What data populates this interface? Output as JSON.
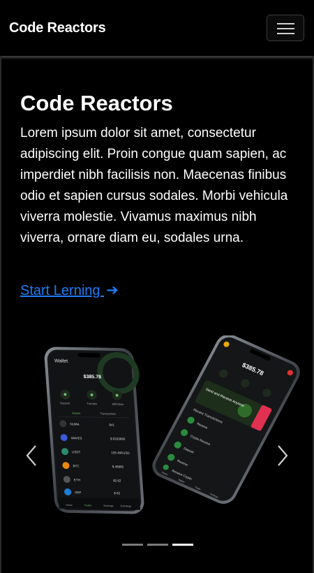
{
  "navbar": {
    "brand": "Code Reactors",
    "toggler_icon": "hamburger-menu-icon"
  },
  "hero": {
    "title": "Code Reactors",
    "text": "Lorem ipsum dolor sit amet, consectetur adipiscing elit. Proin congue quam sapien, ac imperdiet nibh facilisis non. Maecenas finibus odio et sapien cursus sodales. Morbi vehicula viverra molestie. Vivamus maximus nibh viverra, ornare diam eu, sodales urna.",
    "cta_label": "Start Lerning ",
    "cta_icon": "arrow-right-icon",
    "cta_color": "#1e7bf5"
  },
  "carousel": {
    "prev_icon": "chevron-left-icon",
    "next_icon": "chevron-right-icon",
    "slide_count": 3,
    "active_index": 2,
    "phone_left": {
      "app_title": "Wallet",
      "balance": "$385.78",
      "actions": [
        "Deposit",
        "Transfer",
        "Withdraw"
      ],
      "tabs": [
        "Assets",
        "Transactions"
      ],
      "assets": [
        {
          "symbol": "NUMA",
          "value": "$41"
        },
        {
          "symbol": "WAVES",
          "value": "$.6333695"
        },
        {
          "symbol": "USDT",
          "value": "105.45KUSD"
        },
        {
          "symbol": "BTC",
          "value": "$.46865"
        },
        {
          "symbol": "ETH",
          "value": "$2.62"
        },
        {
          "symbol": "XRP",
          "value": "$.62"
        }
      ],
      "nav": [
        "Home",
        "Trades",
        "Earnings",
        "Exchange"
      ]
    },
    "phone_right": {
      "balance": "$385.78",
      "promo_text": "Send and Receive Anytime",
      "section": "Recent Transactions",
      "transactions": [
        "Receive",
        "Crypto Receive",
        "Deposit",
        "Receive",
        "Receive Crypto"
      ],
      "nav": [
        "Home",
        "Wallet",
        "Trade",
        "Settings"
      ]
    }
  }
}
